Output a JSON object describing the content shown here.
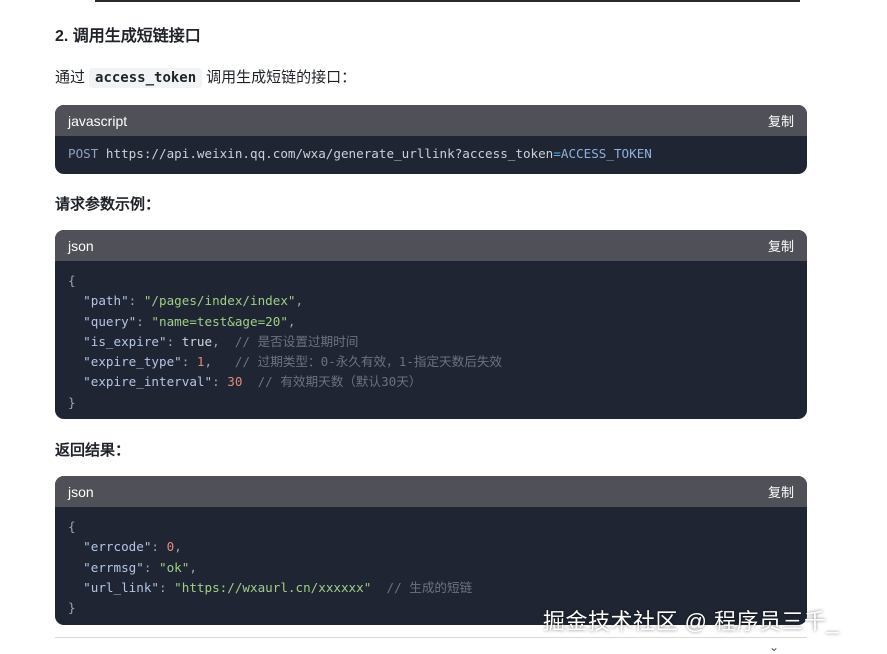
{
  "heading": "2. 调用生成短链接口",
  "intro": {
    "prefix": "通过",
    "code": "access_token",
    "suffix": "调用生成短链的接口："
  },
  "block1": {
    "lang": "javascript",
    "copy": "复制",
    "method": "POST",
    "url_pre": " https://api.weixin.qq.com/wxa/generate_urllink?access_token",
    "eq": "=",
    "token": "ACCESS_TOKEN"
  },
  "request_label": "请求参数示例：",
  "block2": {
    "lang": "json",
    "copy": "复制",
    "open": "{",
    "close": "}",
    "lines": [
      {
        "key": "\"path\"",
        "val": "\"/pages/index/index\"",
        "sep": ",",
        "comment": ""
      },
      {
        "key": "\"query\"",
        "val": "\"name=test&age=20\"",
        "sep": ",",
        "comment": ""
      },
      {
        "key": "\"is_expire\"",
        "val": "true",
        "sep": ",  ",
        "comment": "// 是否设置过期时间"
      },
      {
        "key": "\"expire_type\"",
        "val": "1",
        "sep": ",   ",
        "comment": "// 过期类型：0-永久有效，1-指定天数后失效"
      },
      {
        "key": "\"expire_interval\"",
        "val": "30",
        "sep": "  ",
        "comment": "// 有效期天数（默认30天）"
      }
    ]
  },
  "result_label": "返回结果：",
  "block3": {
    "lang": "json",
    "copy": "复制",
    "open": "{",
    "close": "}",
    "lines": [
      {
        "key": "\"errcode\"",
        "val": "0",
        "sep": ",",
        "comment": ""
      },
      {
        "key": "\"errmsg\"",
        "val": "\"ok\"",
        "sep": ",",
        "comment": ""
      },
      {
        "key": "\"url_link\"",
        "val": "\"https://wxaurl.cn/xxxxxx\"",
        "sep": "  ",
        "comment": "// 生成的短链"
      }
    ]
  },
  "watermark": "掘金技术社区 @ 程序员三千_"
}
